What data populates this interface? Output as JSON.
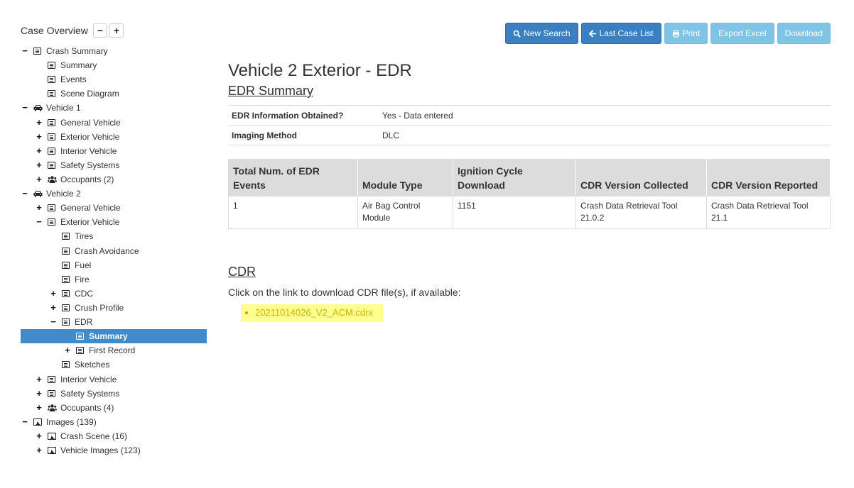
{
  "sidebar": {
    "title": "Case Overview",
    "collapse_label": "−",
    "expand_label": "+",
    "nodes": [
      {
        "label": "Crash Summary",
        "toggle": "−",
        "icon": "list-icon",
        "level": 0
      },
      {
        "label": "Summary",
        "toggle": "",
        "icon": "list-icon",
        "level": 1
      },
      {
        "label": "Events",
        "toggle": "",
        "icon": "list-icon",
        "level": 1
      },
      {
        "label": "Scene Diagram",
        "toggle": "",
        "icon": "list-icon",
        "level": 1
      },
      {
        "label": "Vehicle 1",
        "toggle": "−",
        "icon": "car-icon",
        "level": 0
      },
      {
        "label": "General Vehicle",
        "toggle": "+",
        "icon": "list-icon",
        "level": 1
      },
      {
        "label": "Exterior Vehicle",
        "toggle": "+",
        "icon": "list-icon",
        "level": 1
      },
      {
        "label": "Interior Vehicle",
        "toggle": "+",
        "icon": "list-icon",
        "level": 1
      },
      {
        "label": "Safety Systems",
        "toggle": "+",
        "icon": "list-icon",
        "level": 1
      },
      {
        "label": "Occupants (2)",
        "toggle": "+",
        "icon": "users-icon",
        "level": 1
      },
      {
        "label": "Vehicle 2",
        "toggle": "−",
        "icon": "car-icon",
        "level": 0
      },
      {
        "label": "General Vehicle",
        "toggle": "+",
        "icon": "list-icon",
        "level": 1
      },
      {
        "label": "Exterior Vehicle",
        "toggle": "−",
        "icon": "list-icon",
        "level": 1
      },
      {
        "label": "Tires",
        "toggle": "",
        "icon": "list-icon",
        "level": 2
      },
      {
        "label": "Crash Avoidance",
        "toggle": "",
        "icon": "list-icon",
        "level": 2
      },
      {
        "label": "Fuel",
        "toggle": "",
        "icon": "list-icon",
        "level": 2
      },
      {
        "label": "Fire",
        "toggle": "",
        "icon": "list-icon",
        "level": 2
      },
      {
        "label": "CDC",
        "toggle": "+",
        "icon": "list-icon",
        "level": 2
      },
      {
        "label": "Crush Profile",
        "toggle": "+",
        "icon": "list-icon",
        "level": 2
      },
      {
        "label": "EDR",
        "toggle": "−",
        "icon": "list-icon",
        "level": 2
      },
      {
        "label": "Summary",
        "toggle": "",
        "icon": "list-icon",
        "level": 3,
        "selected": true
      },
      {
        "label": "First Record",
        "toggle": "+",
        "icon": "list-icon",
        "level": 3
      },
      {
        "label": "Sketches",
        "toggle": "",
        "icon": "list-icon",
        "level": 2
      },
      {
        "label": "Interior Vehicle",
        "toggle": "+",
        "icon": "list-icon",
        "level": 1
      },
      {
        "label": "Safety Systems",
        "toggle": "+",
        "icon": "list-icon",
        "level": 1
      },
      {
        "label": "Occupants (4)",
        "toggle": "+",
        "icon": "users-icon",
        "level": 1
      },
      {
        "label": "Images (139)",
        "toggle": "−",
        "icon": "image-icon",
        "level": 0
      },
      {
        "label": "Crash Scene (16)",
        "toggle": "+",
        "icon": "image-icon",
        "level": 1
      },
      {
        "label": "Vehicle Images (123)",
        "toggle": "+",
        "icon": "image-icon",
        "level": 1
      }
    ]
  },
  "toolbar": {
    "new_search": "New Search",
    "last_case_list": "Last Case List",
    "print": "Print",
    "export_excel": "Export Excel",
    "download": "Download"
  },
  "main": {
    "page_title": "Vehicle 2 Exterior - EDR",
    "edr_summary_title": "EDR Summary",
    "summary_rows": [
      {
        "key": "EDR Information Obtained?",
        "value": "Yes - Data entered"
      },
      {
        "key": "Imaging Method",
        "value": "DLC"
      }
    ],
    "edr_table": {
      "headers": [
        "Total Num. of EDR Events",
        "Module Type",
        "Ignition Cycle Download",
        "CDR Version Collected",
        "CDR Version Reported"
      ],
      "rows": [
        [
          "1",
          "Air Bag Control Module",
          "1151",
          "Crash Data Retrieval Tool 21.0.2",
          "Crash Data Retrieval Tool 21.1"
        ]
      ]
    },
    "cdr_title": "CDR",
    "cdr_desc": "Click on the link to download CDR file(s), if available:",
    "cdr_files": [
      "20211014026_V2_ACM.cdrx"
    ]
  },
  "colors": {
    "primary": "#3a7fc1",
    "light": "#7fc4e6",
    "selected": "#428bca",
    "highlight": "#ffff8f"
  }
}
